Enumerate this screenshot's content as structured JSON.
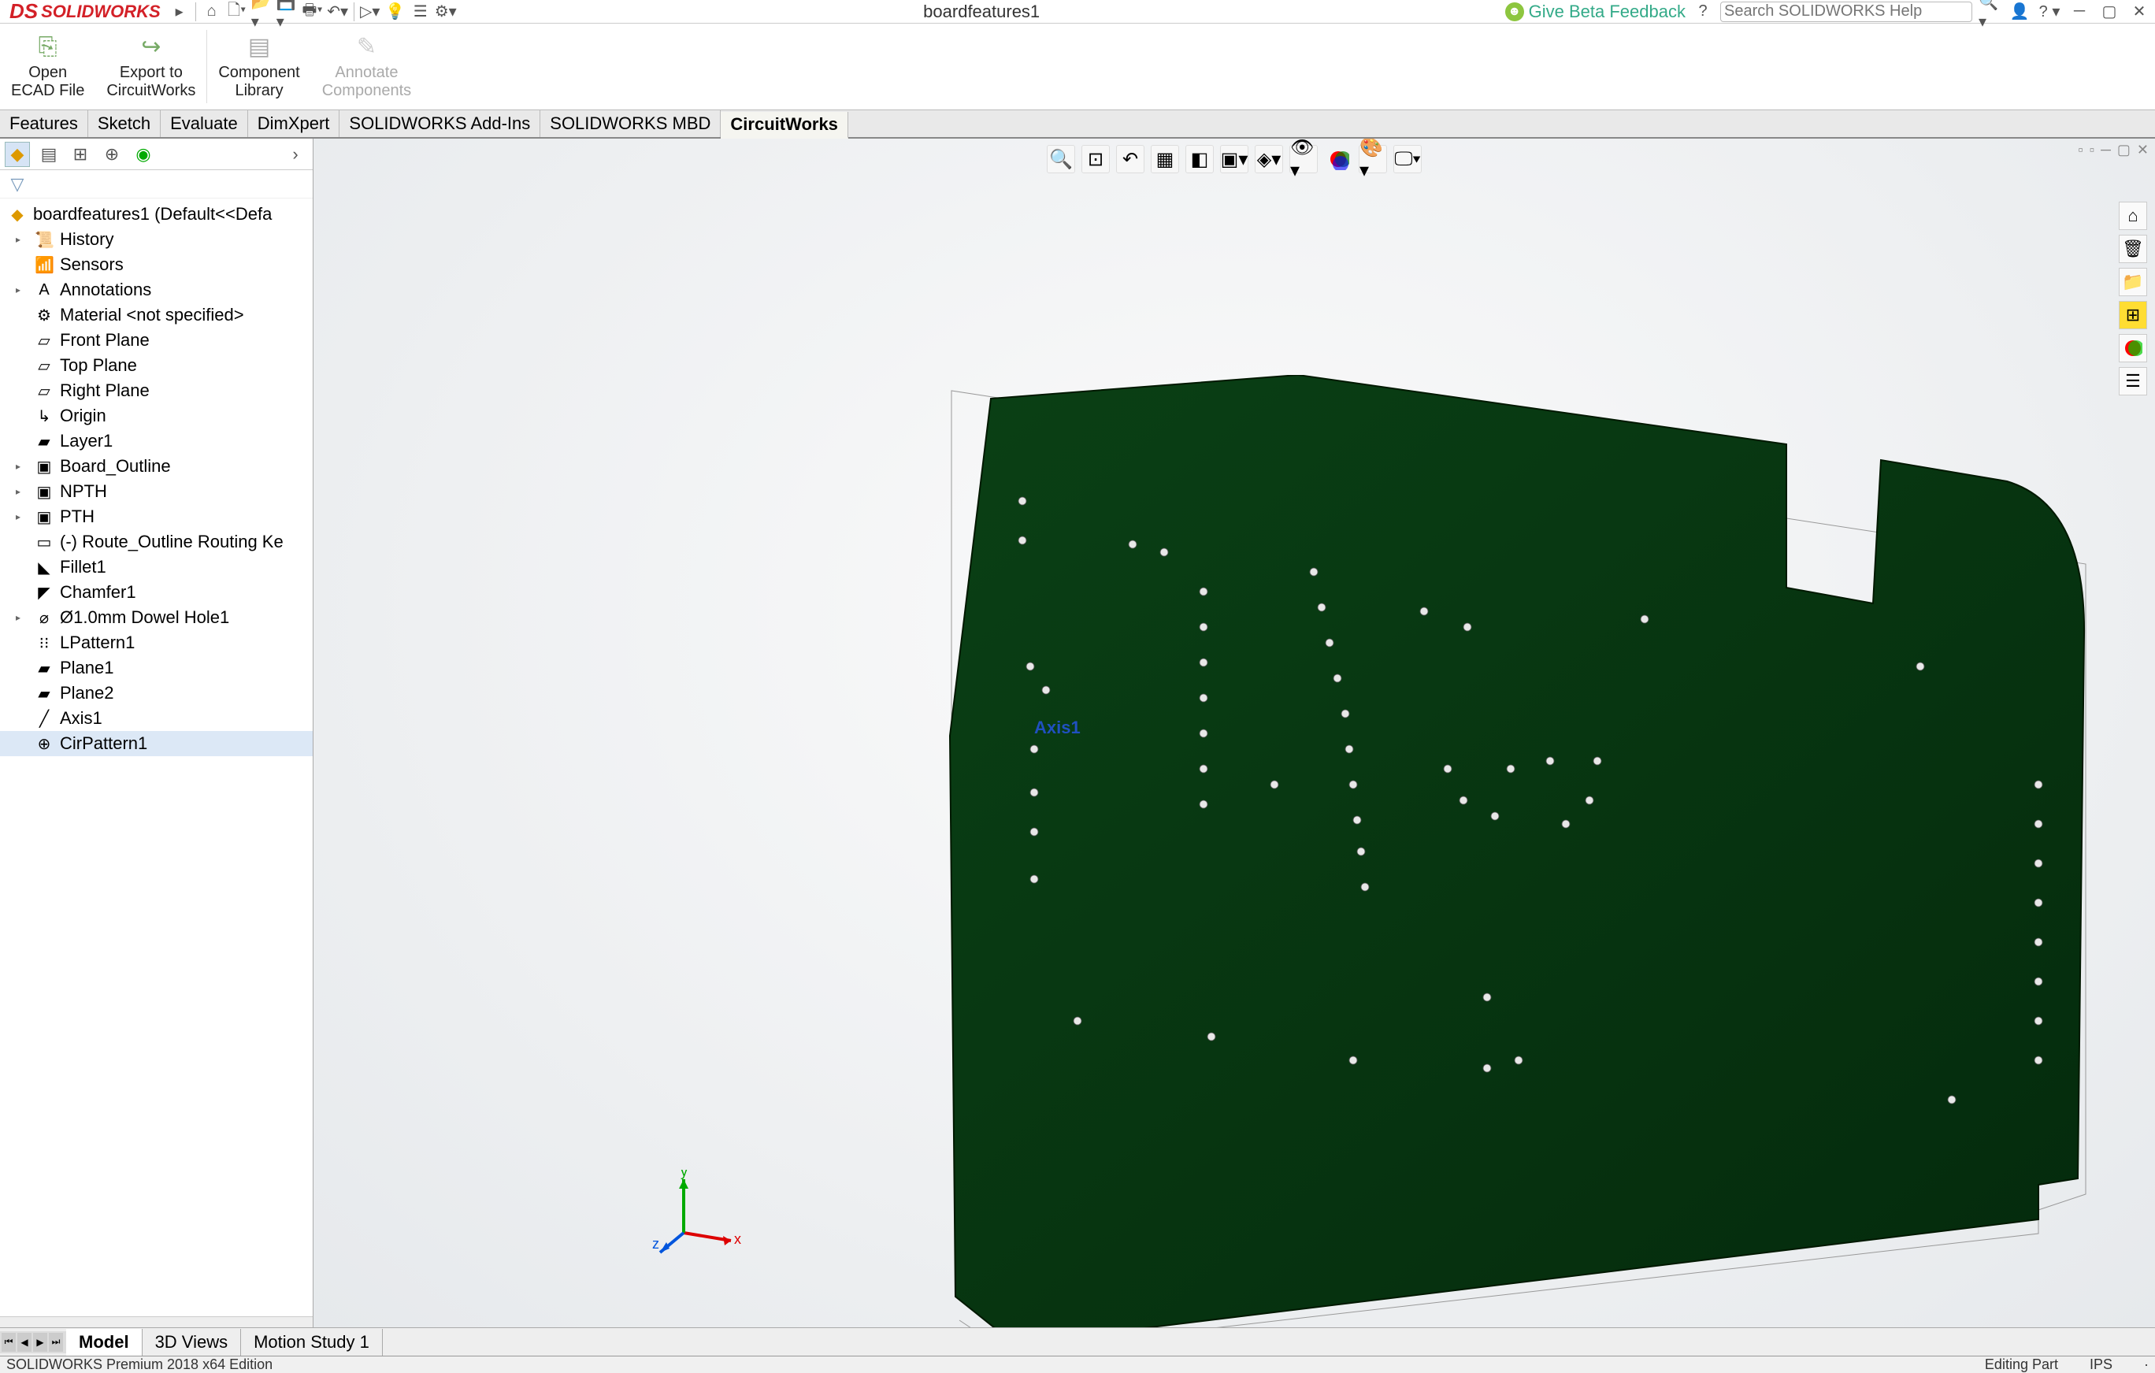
{
  "app": {
    "name": "SOLIDWORKS",
    "logo_prefix": "DS"
  },
  "title": "boardfeatures1",
  "feedback_label": "Give Beta Feedback",
  "search_placeholder": "Search SOLIDWORKS Help",
  "ribbon": {
    "open_ecad": "Open\nECAD File",
    "export_cw": "Export to\nCircuitWorks",
    "comp_lib": "Component\nLibrary",
    "annotate": "Annotate\nComponents"
  },
  "cmd_tabs": [
    "Features",
    "Sketch",
    "Evaluate",
    "DimXpert",
    "SOLIDWORKS Add-Ins",
    "SOLIDWORKS MBD",
    "CircuitWorks"
  ],
  "active_cmd_tab": 6,
  "tree_root": "boardfeatures1  (Default<<Defa",
  "tree": [
    {
      "expand": "▸",
      "icon": "📜",
      "label": "History",
      "name": "history-folder"
    },
    {
      "expand": "",
      "icon": "📶",
      "label": "Sensors",
      "name": "sensors"
    },
    {
      "expand": "▸",
      "icon": "A",
      "label": "Annotations",
      "name": "annotations-folder"
    },
    {
      "expand": "",
      "icon": "⚙",
      "label": "Material <not specified>",
      "name": "material"
    },
    {
      "expand": "",
      "icon": "▱",
      "label": "Front Plane",
      "name": "front-plane"
    },
    {
      "expand": "",
      "icon": "▱",
      "label": "Top Plane",
      "name": "top-plane"
    },
    {
      "expand": "",
      "icon": "▱",
      "label": "Right Plane",
      "name": "right-plane"
    },
    {
      "expand": "",
      "icon": "↳",
      "label": "Origin",
      "name": "origin"
    },
    {
      "expand": "",
      "icon": "▰",
      "label": "Layer1",
      "name": "layer1"
    },
    {
      "expand": "▸",
      "icon": "▣",
      "label": "Board_Outline",
      "name": "board-outline"
    },
    {
      "expand": "▸",
      "icon": "▣",
      "label": "NPTH",
      "name": "npth"
    },
    {
      "expand": "▸",
      "icon": "▣",
      "label": "PTH",
      "name": "pth"
    },
    {
      "expand": "",
      "icon": "▭",
      "label": "(-) Route_Outline Routing Ke",
      "name": "route-outline"
    },
    {
      "expand": "",
      "icon": "◣",
      "label": "Fillet1",
      "name": "fillet1"
    },
    {
      "expand": "",
      "icon": "◤",
      "label": "Chamfer1",
      "name": "chamfer1"
    },
    {
      "expand": "▸",
      "icon": "⌀",
      "label": "Ø1.0mm Dowel Hole1",
      "name": "dowel-hole"
    },
    {
      "expand": "",
      "icon": "⁝⁝",
      "label": "LPattern1",
      "name": "lpattern1"
    },
    {
      "expand": "",
      "icon": "▰",
      "label": "Plane1",
      "name": "plane1"
    },
    {
      "expand": "",
      "icon": "▰",
      "label": "Plane2",
      "name": "plane2"
    },
    {
      "expand": "",
      "icon": "╱",
      "label": "Axis1",
      "name": "axis1"
    },
    {
      "expand": "",
      "icon": "⊕",
      "label": "CirPattern1",
      "name": "cirpattern1",
      "hl": true
    }
  ],
  "axis_label": "Axis1",
  "bottom_tabs": [
    "Model",
    "3D Views",
    "Motion Study 1"
  ],
  "active_bottom_tab": 0,
  "status": {
    "left": "SOLIDWORKS Premium 2018 x64 Edition",
    "mode": "Editing Part",
    "units": "IPS"
  }
}
